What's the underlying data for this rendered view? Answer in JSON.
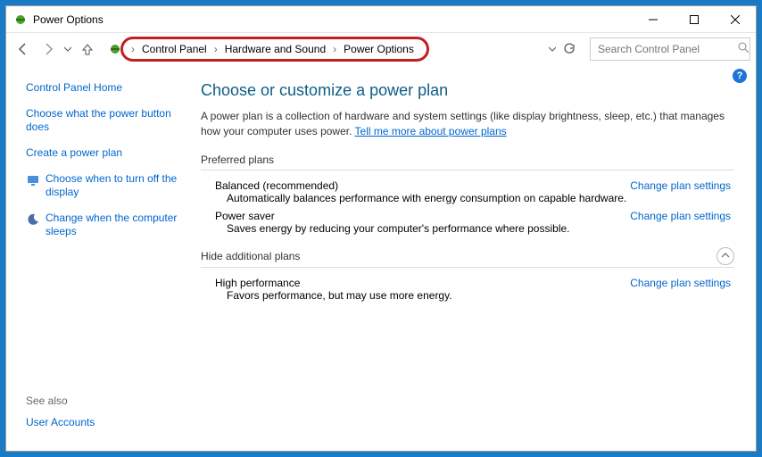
{
  "window": {
    "title": "Power Options"
  },
  "breadcrumb": {
    "items": [
      "Control Panel",
      "Hardware and Sound",
      "Power Options"
    ]
  },
  "search": {
    "placeholder": "Search Control Panel"
  },
  "sidebar": {
    "home": "Control Panel Home",
    "links": [
      "Choose what the power button does",
      "Create a power plan",
      "Choose when to turn off the display",
      "Change when the computer sleeps"
    ],
    "see_also_label": "See also",
    "see_also_links": [
      "User Accounts"
    ]
  },
  "main": {
    "heading": "Choose or customize a power plan",
    "desc_prefix": "A power plan is a collection of hardware and system settings (like display brightness, sleep, etc.) that manages how your computer uses power. ",
    "desc_link": "Tell me more about power plans",
    "preferred_label": "Preferred plans",
    "plans": [
      {
        "name": "Balanced (recommended)",
        "sub": "Automatically balances performance with energy consumption on capable hardware.",
        "link": "Change plan settings",
        "checked": true,
        "bold": true
      },
      {
        "name": "Power saver",
        "sub": "Saves energy by reducing your computer's performance where possible.",
        "link": "Change plan settings",
        "checked": false,
        "bold": false
      }
    ],
    "hide_label": "Hide additional plans",
    "extra_plans": [
      {
        "name": "High performance",
        "sub": "Favors performance, but may use more energy.",
        "link": "Change plan settings",
        "checked": false,
        "bold": false
      }
    ]
  }
}
